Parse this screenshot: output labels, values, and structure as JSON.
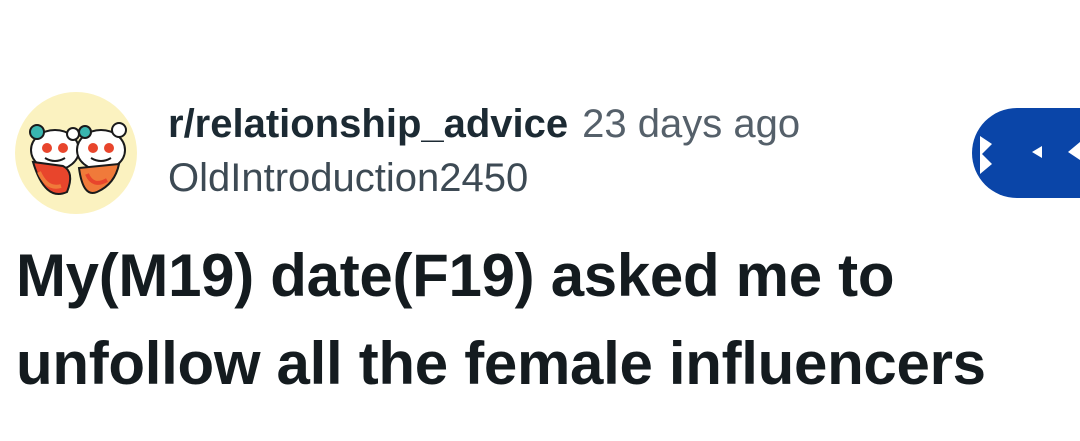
{
  "post": {
    "subreddit": "r/relationship_advice",
    "time_ago": "23 days ago",
    "author": "OldIntroduction2450",
    "title": "My(M19) date(F19) asked me to unfollow all the female influencers"
  },
  "icons": {
    "avatar": "subreddit-avatar-icon",
    "join": "join-button-icon"
  },
  "colors": {
    "avatar_bg": "#fbf2c0",
    "join_button": "#0a45a8",
    "heart_red": "#e8452c",
    "heart_orange": "#f07a3a",
    "snoo_teal": "#39b6b0"
  }
}
